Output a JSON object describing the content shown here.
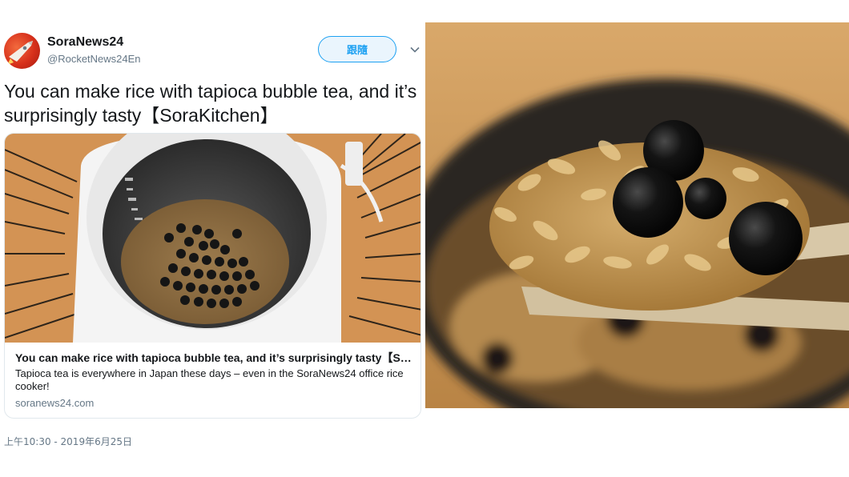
{
  "tweet": {
    "author": {
      "name": "SoraNews24",
      "handle": "@RocketNews24En"
    },
    "follow_label": "跟隨",
    "text": "You can make rice with tapioca bubble tea, and it’s surprisingly tasty【SoraKitchen】",
    "card": {
      "title": "You can make rice with tapioca bubble tea, and it’s surprisingly tasty【SoraK...",
      "description": "Tapioca tea is everywhere in Japan these days – even in the SoraNews24 office rice cooker!",
      "domain": "soranews24.com"
    },
    "timestamp": "上午10:30 - 2019年6月25日"
  },
  "colors": {
    "accent": "#1da1f2",
    "secondary_text": "#657786",
    "border": "#e1e8ed"
  },
  "icons": {
    "avatar": "rocket-logo",
    "caret": "chevron-down-icon"
  }
}
